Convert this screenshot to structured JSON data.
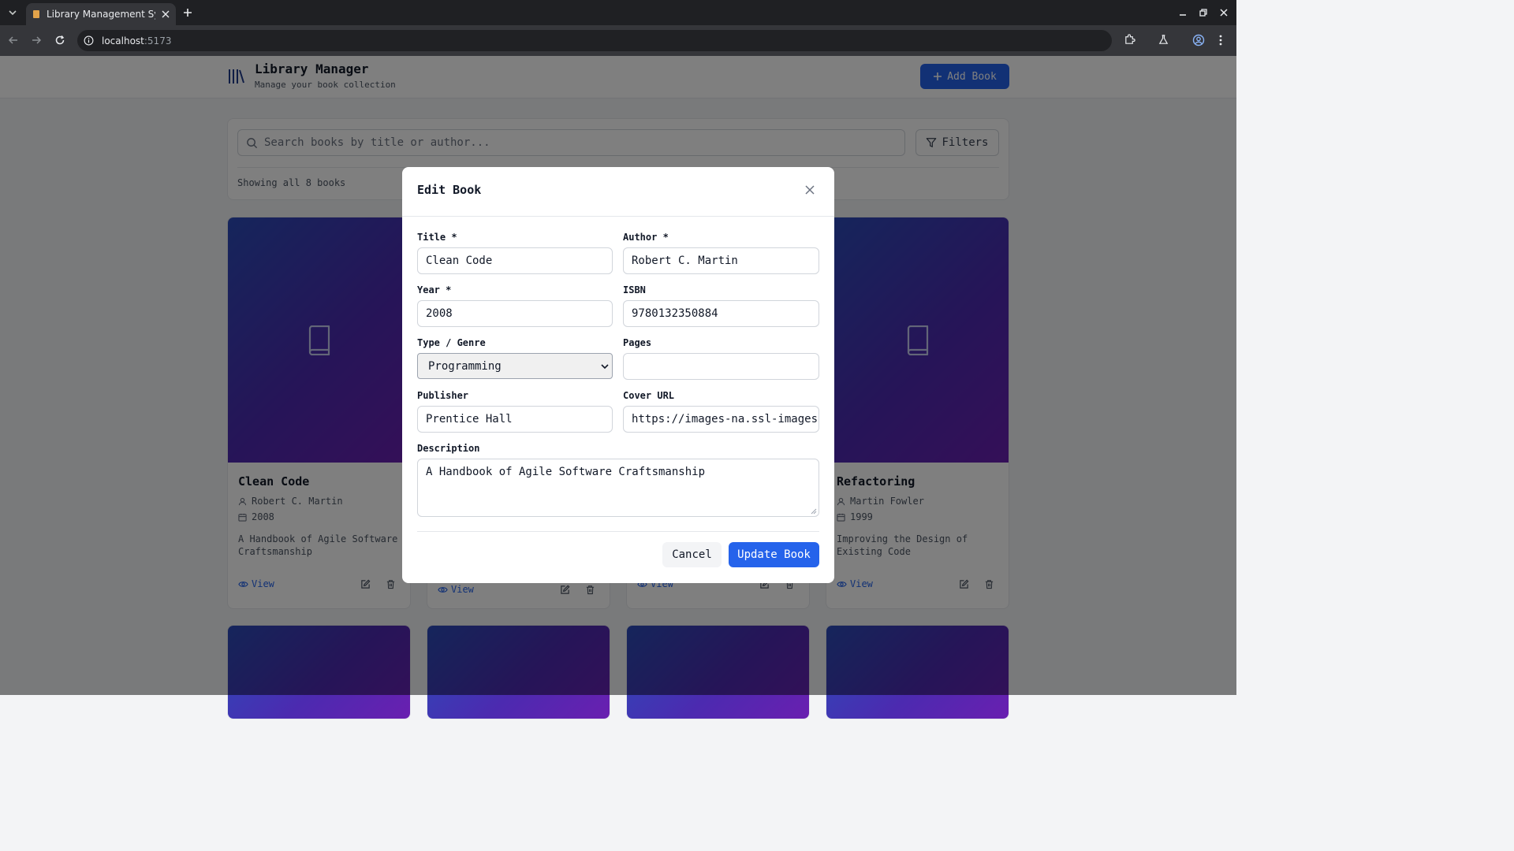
{
  "browser": {
    "tab_title": "Library Management Sy",
    "url_host": "localhost",
    "url_port": ":5173"
  },
  "header": {
    "title": "Library Manager",
    "subtitle": "Manage your book collection",
    "add_button": "Add Book"
  },
  "search": {
    "placeholder": "Search books by title or author...",
    "filters_label": "Filters",
    "showing_text": "Showing all 8 books"
  },
  "books": [
    {
      "title": "Clean Code",
      "author": "Robert C. Martin",
      "year": "2008",
      "description": "A Handbook of Agile Software Craftsmanship",
      "view_label": "View"
    },
    {
      "view_label": "View"
    },
    {
      "view_label": "View"
    },
    {
      "title": "Refactoring",
      "author": "Martin Fowler",
      "year": "1999",
      "description": "Improving the Design of Existing Code",
      "view_label": "View"
    }
  ],
  "modal": {
    "title": "Edit Book",
    "labels": {
      "title": "Title *",
      "author": "Author *",
      "year": "Year *",
      "isbn": "ISBN",
      "genre": "Type / Genre",
      "pages": "Pages",
      "publisher": "Publisher",
      "cover_url": "Cover URL",
      "description": "Description"
    },
    "values": {
      "title": "Clean Code",
      "author": "Robert C. Martin",
      "year": "2008",
      "isbn": "9780132350884",
      "genre": "Programming",
      "pages": "",
      "publisher": "Prentice Hall",
      "cover_url": "https://images-na.ssl-images-",
      "description": "A Handbook of Agile Software Craftsmanship"
    },
    "cancel_label": "Cancel",
    "submit_label": "Update Book"
  },
  "colors": {
    "primary": "#2563eb",
    "cover_gradient_start": "#2b4bb8",
    "cover_gradient_end": "#6a1fb0"
  }
}
